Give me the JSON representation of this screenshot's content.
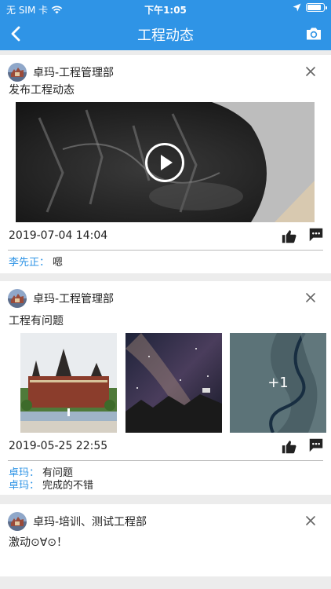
{
  "status_bar": {
    "carrier": "无 SIM 卡",
    "time": "下午1:05",
    "battery_level": 0.9
  },
  "nav": {
    "title": "工程动态",
    "back_icon": "back-chevron-icon",
    "camera_icon": "camera-icon"
  },
  "colors": {
    "accent": "#2f94e6",
    "link": "#2f94e6",
    "background": "#ececec"
  },
  "posts": [
    {
      "author": "卓玛-工程管理部",
      "text": "发布工程动态",
      "media": {
        "kind": "video",
        "icon": "play-icon"
      },
      "time": "2019-07-04 14:04",
      "comments": [
        {
          "user": "李先正",
          "sep": "：",
          "text": "嗯"
        }
      ]
    },
    {
      "author": "卓玛-工程管理部",
      "text": "工程有问题",
      "media": {
        "kind": "images",
        "more_count": "+1"
      },
      "time": "2019-05-25 22:55",
      "comments": [
        {
          "user": "卓玛",
          "sep": "：",
          "text": "有问题"
        },
        {
          "user": "卓玛",
          "sep": "：",
          "text": "完成的不错"
        }
      ]
    },
    {
      "author": "卓玛-培训、测试工程部",
      "text": "激动⊙∀⊙！",
      "media": null,
      "time": "",
      "comments": []
    }
  ]
}
